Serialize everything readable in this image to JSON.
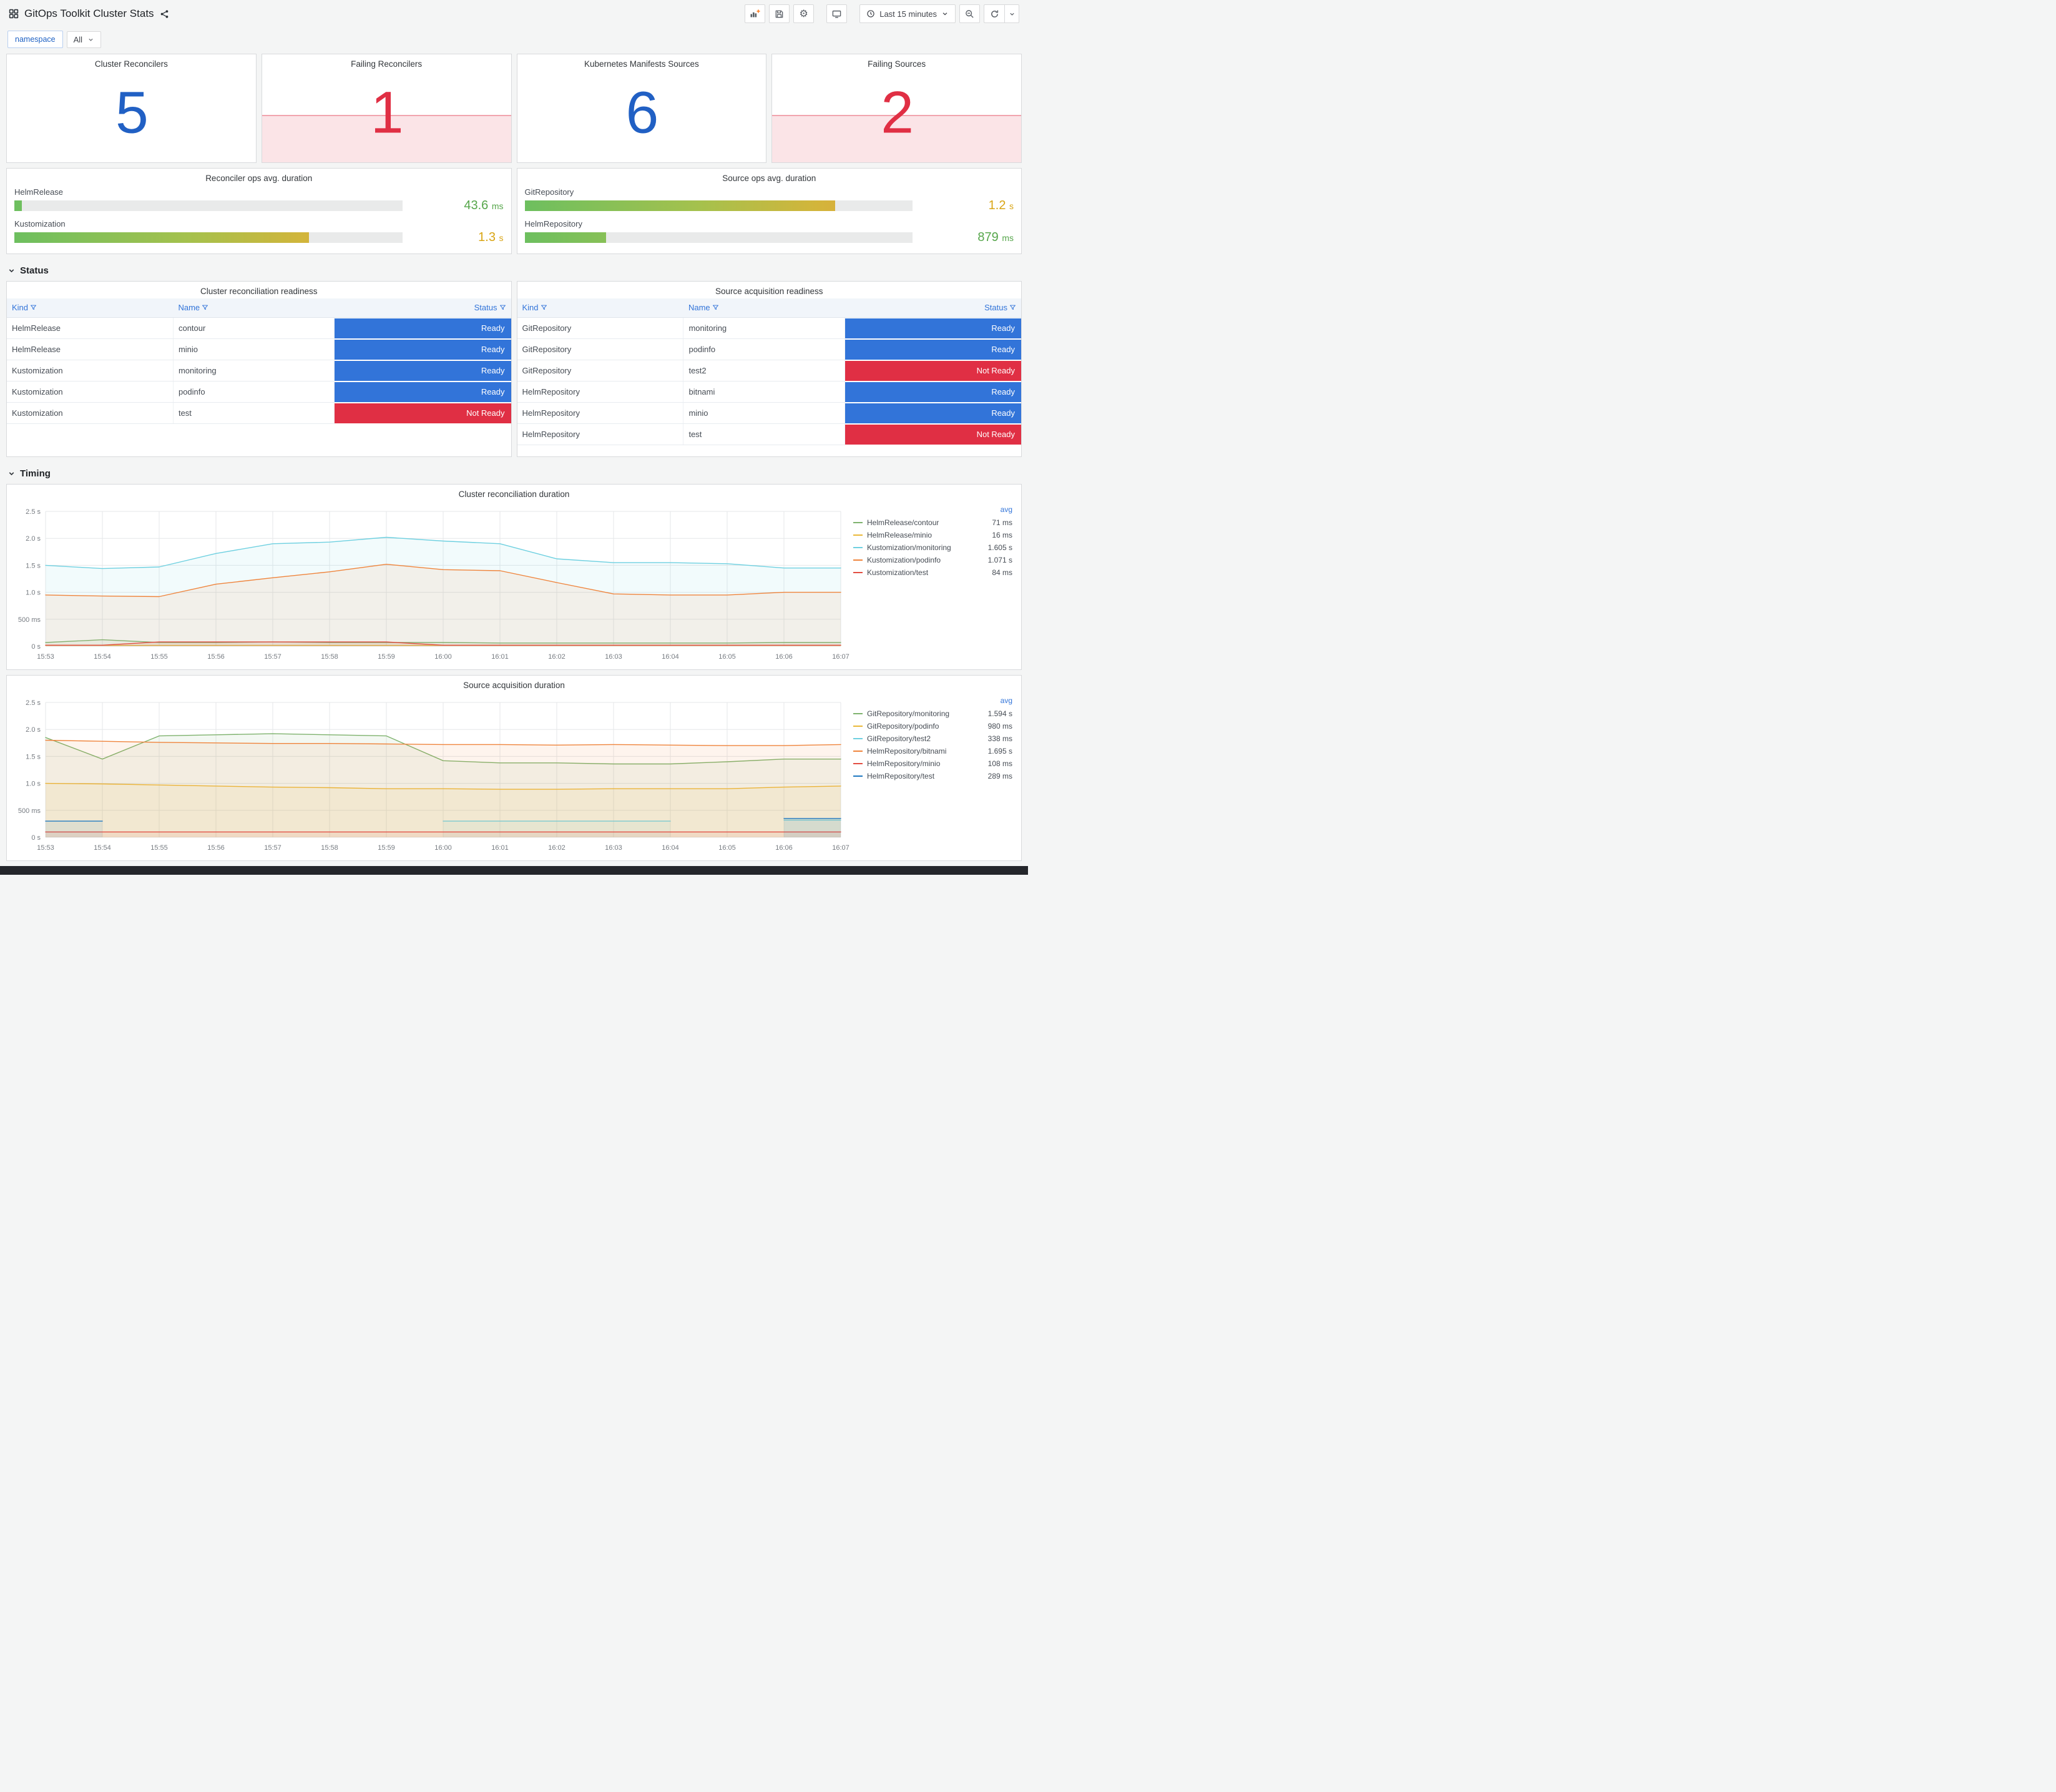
{
  "navbar": {
    "title": "GitOps Toolkit Cluster Stats",
    "time_range": "Last 15 minutes"
  },
  "variables": {
    "label": "namespace",
    "value": "All"
  },
  "sections": {
    "status": "Status",
    "timing": "Timing"
  },
  "colors": {
    "stat_ok": "#2160c4",
    "stat_fail": "#e02f44",
    "stat_fail_bg": "rgba(224,47,68,0.13)",
    "stat_fail_line": "rgba(224,47,68,0.35)",
    "ready": "#3274d9",
    "not_ready": "#e02f44",
    "green": "#56a64b",
    "amber": "#d9a514"
  },
  "stat_panels": [
    {
      "title": "Cluster Reconcilers",
      "value": "5",
      "state": "ok"
    },
    {
      "title": "Failing Reconcilers",
      "value": "1",
      "state": "failing"
    },
    {
      "title": "Kubernetes Manifests Sources",
      "value": "6",
      "state": "ok"
    },
    {
      "title": "Failing Sources",
      "value": "2",
      "state": "failing"
    }
  ],
  "gauge_panels": [
    {
      "title": "Reconciler ops avg. duration",
      "rows": [
        {
          "label": "HelmRelease",
          "value": "43.6",
          "unit": "ms",
          "pct": 2,
          "value_color": "#56a64b"
        },
        {
          "label": "Kustomization",
          "value": "1.3",
          "unit": "s",
          "pct": 76,
          "value_color": "#d9a514"
        }
      ]
    },
    {
      "title": "Source ops avg. duration",
      "rows": [
        {
          "label": "GitRepository",
          "value": "1.2",
          "unit": "s",
          "pct": 80,
          "value_color": "#d9a514"
        },
        {
          "label": "HelmRepository",
          "value": "879",
          "unit": "ms",
          "pct": 21,
          "value_color": "#56a64b"
        }
      ]
    }
  ],
  "tables": [
    {
      "title": "Cluster reconciliation readiness",
      "columns": [
        "Kind",
        "Name",
        "Status"
      ],
      "rows": [
        [
          "HelmRelease",
          "contour",
          "Ready"
        ],
        [
          "HelmRelease",
          "minio",
          "Ready"
        ],
        [
          "Kustomization",
          "monitoring",
          "Ready"
        ],
        [
          "Kustomization",
          "podinfo",
          "Ready"
        ],
        [
          "Kustomization",
          "test",
          "Not Ready"
        ]
      ]
    },
    {
      "title": "Source acquisition readiness",
      "columns": [
        "Kind",
        "Name",
        "Status"
      ],
      "rows": [
        [
          "GitRepository",
          "monitoring",
          "Ready"
        ],
        [
          "GitRepository",
          "podinfo",
          "Ready"
        ],
        [
          "GitRepository",
          "test2",
          "Not Ready"
        ],
        [
          "HelmRepository",
          "bitnami",
          "Ready"
        ],
        [
          "HelmRepository",
          "minio",
          "Ready"
        ],
        [
          "HelmRepository",
          "test",
          "Not Ready"
        ]
      ]
    }
  ],
  "chart_data": [
    {
      "type": "line",
      "title": "Cluster reconciliation duration",
      "legend_header": "avg",
      "ylim": [
        0,
        2.5
      ],
      "yticks": [
        {
          "v": 0,
          "label": "0 s"
        },
        {
          "v": 0.5,
          "label": "500 ms"
        },
        {
          "v": 1,
          "label": "1.0 s"
        },
        {
          "v": 1.5,
          "label": "1.5 s"
        },
        {
          "v": 2,
          "label": "2.0 s"
        },
        {
          "v": 2.5,
          "label": "2.5 s"
        }
      ],
      "x": [
        "15:53",
        "15:54",
        "15:55",
        "15:56",
        "15:57",
        "15:58",
        "15:59",
        "16:00",
        "16:01",
        "16:02",
        "16:03",
        "16:04",
        "16:05",
        "16:06",
        "16:07"
      ],
      "series": [
        {
          "name": "HelmRelease/contour",
          "avg": "71 ms",
          "color": "#7EB26D",
          "values": [
            0.07,
            0.12,
            0.07,
            0.07,
            0.08,
            0.07,
            0.07,
            0.07,
            0.06,
            0.06,
            0.06,
            0.06,
            0.06,
            0.07,
            0.07
          ]
        },
        {
          "name": "HelmRelease/minio",
          "avg": "16 ms",
          "color": "#EAB839",
          "values": [
            0.016,
            0.016,
            0.016,
            0.016,
            0.016,
            0.016,
            0.016,
            0.016,
            0.016,
            0.016,
            0.016,
            0.016,
            0.016,
            0.016,
            0.016
          ]
        },
        {
          "name": "Kustomization/monitoring",
          "avg": "1.605 s",
          "color": "#6ED0E0",
          "values": [
            1.5,
            1.44,
            1.47,
            1.72,
            1.9,
            1.93,
            2.02,
            1.95,
            1.9,
            1.62,
            1.55,
            1.55,
            1.53,
            1.45,
            1.45
          ]
        },
        {
          "name": "Kustomization/podinfo",
          "avg": "1.071 s",
          "color": "#EF843C",
          "values": [
            0.95,
            0.93,
            0.92,
            1.15,
            1.27,
            1.38,
            1.52,
            1.42,
            1.4,
            1.18,
            0.97,
            0.95,
            0.95,
            1.0,
            1.0
          ]
        },
        {
          "name": "Kustomization/test",
          "avg": "84 ms",
          "color": "#E24D42",
          "values": [
            0.02,
            0.02,
            0.08,
            0.08,
            0.08,
            0.08,
            0.08,
            0.02,
            0.02,
            0.02,
            0.02,
            0.02,
            0.02,
            0.02,
            0.02
          ]
        }
      ]
    },
    {
      "type": "line",
      "title": "Source acquisition duration",
      "legend_header": "avg",
      "ylim": [
        0,
        2.5
      ],
      "yticks": [
        {
          "v": 0,
          "label": "0 s"
        },
        {
          "v": 0.5,
          "label": "500 ms"
        },
        {
          "v": 1,
          "label": "1.0 s"
        },
        {
          "v": 1.5,
          "label": "1.5 s"
        },
        {
          "v": 2,
          "label": "2.0 s"
        },
        {
          "v": 2.5,
          "label": "2.5 s"
        }
      ],
      "x": [
        "15:53",
        "15:54",
        "15:55",
        "15:56",
        "15:57",
        "15:58",
        "15:59",
        "16:00",
        "16:01",
        "16:02",
        "16:03",
        "16:04",
        "16:05",
        "16:06",
        "16:07"
      ],
      "series": [
        {
          "name": "GitRepository/monitoring",
          "avg": "1.594 s",
          "color": "#7EB26D",
          "values": [
            1.85,
            1.45,
            1.88,
            1.9,
            1.92,
            1.9,
            1.88,
            1.42,
            1.38,
            1.38,
            1.36,
            1.36,
            1.4,
            1.45,
            1.45
          ]
        },
        {
          "name": "GitRepository/podinfo",
          "avg": "980 ms",
          "color": "#EAB839",
          "values": [
            1.0,
            0.99,
            0.97,
            0.95,
            0.93,
            0.92,
            0.9,
            0.9,
            0.89,
            0.89,
            0.9,
            0.9,
            0.9,
            0.93,
            0.95
          ]
        },
        {
          "name": "GitRepository/test2",
          "avg": "338 ms",
          "color": "#6ED0E0",
          "values": [
            null,
            null,
            null,
            null,
            null,
            null,
            null,
            0.3,
            0.3,
            0.3,
            0.3,
            0.3,
            null,
            0.32,
            0.32
          ]
        },
        {
          "name": "HelmRepository/bitnami",
          "avg": "1.695 s",
          "color": "#EF843C",
          "values": [
            1.8,
            1.78,
            1.76,
            1.75,
            1.74,
            1.74,
            1.73,
            1.72,
            1.72,
            1.71,
            1.72,
            1.71,
            1.7,
            1.7,
            1.72
          ]
        },
        {
          "name": "HelmRepository/minio",
          "avg": "108 ms",
          "color": "#E24D42",
          "values": [
            0.1,
            0.1,
            0.1,
            0.1,
            0.1,
            0.1,
            0.1,
            0.1,
            0.1,
            0.1,
            0.1,
            0.1,
            0.1,
            0.1,
            0.1
          ]
        },
        {
          "name": "HelmRepository/test",
          "avg": "289 ms",
          "color": "#1F78C1",
          "values": [
            0.3,
            0.3,
            null,
            null,
            null,
            null,
            null,
            null,
            null,
            null,
            null,
            null,
            null,
            0.35,
            0.35
          ]
        }
      ]
    }
  ]
}
